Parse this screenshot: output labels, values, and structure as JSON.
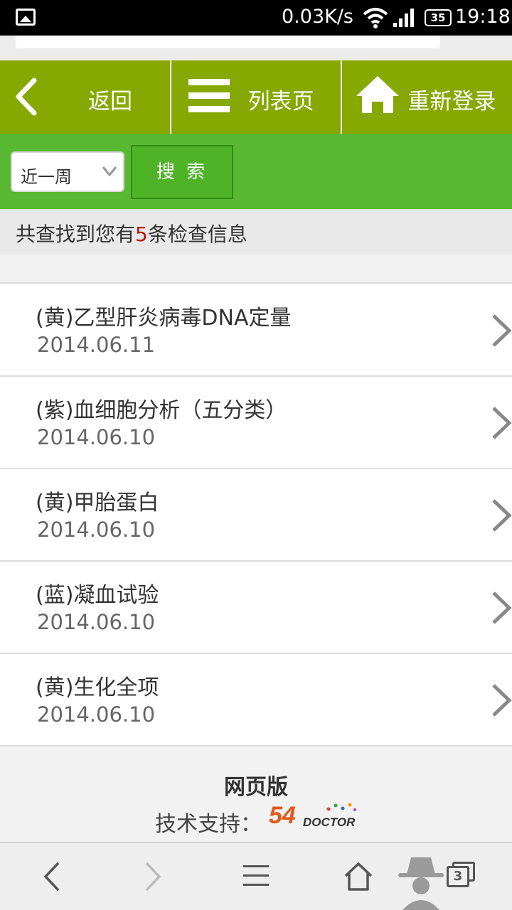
{
  "status_bar": {
    "speed": "0.03K/s",
    "battery": "35",
    "time": "19:18"
  },
  "nav": {
    "back_label": "返回",
    "list_label": "列表页",
    "relogin_label": "重新登录"
  },
  "search": {
    "period_selected": "近一周",
    "search_button": "搜 索"
  },
  "summary": {
    "prefix": "共查找到您有",
    "count": "5",
    "suffix": "条检查信息"
  },
  "records": [
    {
      "title": "(黄)乙型肝炎病毒DNA定量",
      "date": "2014.06.11"
    },
    {
      "title": "(紫)血细胞分析（五分类）",
      "date": "2014.06.10"
    },
    {
      "title": "(黄)甲胎蛋白",
      "date": "2014.06.10"
    },
    {
      "title": "(蓝)凝血试验",
      "date": "2014.06.10"
    },
    {
      "title": "(黄)生化全项",
      "date": "2014.06.10"
    }
  ],
  "footer": {
    "web_version": "网页版",
    "support_label": "技术支持：",
    "logo_number": "54",
    "logo_text": "DOCTOR"
  },
  "browser": {
    "tab_count": "3"
  },
  "colors": {
    "nav_bg": "#86a800",
    "search_bg": "#58b831",
    "count_red": "#c21010"
  }
}
